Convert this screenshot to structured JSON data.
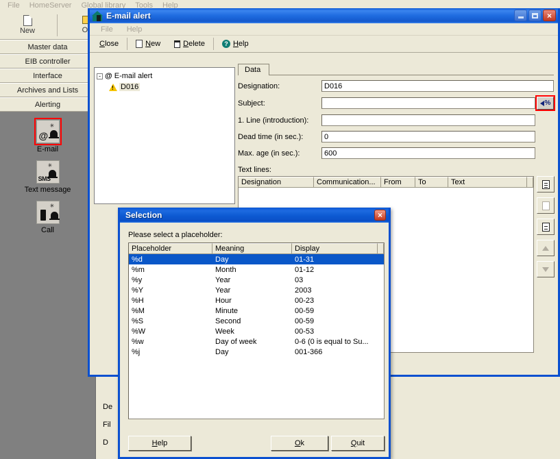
{
  "app": {
    "menu": [
      "File",
      "HomeServer",
      "Global library",
      "Tools",
      "Help"
    ],
    "toolbar": [
      {
        "label": "New",
        "icon": "new-document-icon"
      },
      {
        "label": "Op",
        "icon": "open-folder-icon"
      }
    ],
    "nav_buttons": [
      "Master data",
      "EIB controller",
      "Interface",
      "Archives and Lists",
      "Alerting"
    ],
    "nav_icons": [
      {
        "label": "E-mail",
        "icon": "email-alert-icon",
        "selected": true
      },
      {
        "label": "Text message",
        "icon": "sms-alert-icon",
        "selected": false
      },
      {
        "label": "Call",
        "icon": "phone-alert-icon",
        "selected": false
      }
    ],
    "hidden_labels": [
      "De",
      "Fil",
      "D"
    ]
  },
  "mail_window": {
    "title": "E-mail alert",
    "title_icon": "home-icon",
    "window_buttons": {
      "minimize": "minimize-icon",
      "maximize": "maximize-icon",
      "close": "×"
    },
    "menu": [
      "File",
      "Help"
    ],
    "toolbar": [
      {
        "label": "Close",
        "accel": "C",
        "icon": null
      },
      {
        "label": "New",
        "accel": "N",
        "icon": "new-document-icon"
      },
      {
        "label": "Delete",
        "accel": "D",
        "icon": "trash-icon"
      },
      {
        "label": "Help",
        "accel": "H",
        "icon": "help-circle-icon"
      }
    ],
    "tree": {
      "root": {
        "label": "E-mail alert",
        "icon": "email-alert-icon",
        "expander": "-"
      },
      "children": [
        {
          "label": "D016",
          "icon": "warning-triangle-icon",
          "selected": true
        }
      ]
    },
    "tabs": [
      {
        "label": "Data",
        "active": true
      }
    ],
    "fields": [
      {
        "label": "Designation:",
        "value": "D016",
        "name": "designation"
      },
      {
        "label": "Subject:",
        "value": "",
        "name": "subject",
        "has_placeholder_button": true
      },
      {
        "label": "1. Line (introduction):",
        "value": "",
        "name": "intro-line"
      },
      {
        "label": "Dead time (in sec.):",
        "value": "0",
        "name": "dead-time"
      },
      {
        "label": "Max. age (in sec.):",
        "value": "600",
        "name": "max-age"
      }
    ],
    "placeholder_button": {
      "icon": "insert-placeholder-icon",
      "symbol": "%",
      "highlight_color": "#ff0000"
    },
    "textlines": {
      "label": "Text lines:",
      "columns": [
        "Designation",
        "Communication...",
        "From",
        "To",
        "Text",
        ""
      ],
      "rows": []
    },
    "grid_toolbar": [
      {
        "name": "new-row-button",
        "icon": "document-icon",
        "enabled": true
      },
      {
        "name": "copy-row-button",
        "icon": "copy-icon",
        "enabled": false
      },
      {
        "name": "edit-row-button",
        "icon": "edit-document-icon",
        "enabled": true
      },
      {
        "name": "move-up-button",
        "icon": "arrow-up-icon",
        "enabled": false
      },
      {
        "name": "move-down-button",
        "icon": "arrow-down-icon",
        "enabled": false
      }
    ]
  },
  "selection_dialog": {
    "title": "Selection",
    "close_label": "×",
    "prompt": "Please select a placeholder:",
    "columns": [
      "Placeholder",
      "Meaning",
      "Display"
    ],
    "rows": [
      {
        "placeholder": "%d",
        "meaning": "Day",
        "display": "01-31",
        "selected": true
      },
      {
        "placeholder": "%m",
        "meaning": "Month",
        "display": "01-12",
        "selected": false
      },
      {
        "placeholder": "%y",
        "meaning": "Year",
        "display": "03",
        "selected": false
      },
      {
        "placeholder": "%Y",
        "meaning": "Year",
        "display": "2003",
        "selected": false
      },
      {
        "placeholder": "%H",
        "meaning": "Hour",
        "display": "00-23",
        "selected": false
      },
      {
        "placeholder": "%M",
        "meaning": "Minute",
        "display": "00-59",
        "selected": false
      },
      {
        "placeholder": "%S",
        "meaning": "Second",
        "display": "00-59",
        "selected": false
      },
      {
        "placeholder": "%W",
        "meaning": "Week",
        "display": "00-53",
        "selected": false
      },
      {
        "placeholder": "%w",
        "meaning": "Day of week",
        "display": "0-6 (0 is equal to Su...",
        "selected": false
      },
      {
        "placeholder": "%j",
        "meaning": "Day",
        "display": "001-366",
        "selected": false
      }
    ],
    "buttons": [
      {
        "label": "Help",
        "accel": "H",
        "name": "help-button"
      },
      {
        "label": "Ok",
        "accel": "O",
        "name": "ok-button"
      },
      {
        "label": "Quit",
        "accel": "Q",
        "name": "quit-button"
      }
    ]
  },
  "colors": {
    "titlebar_blue": "#0b57d4",
    "selection_blue": "#0a57c8",
    "window_face": "#ece9d8",
    "highlight_red": "#ff0000",
    "desktop_gray": "#808080"
  }
}
